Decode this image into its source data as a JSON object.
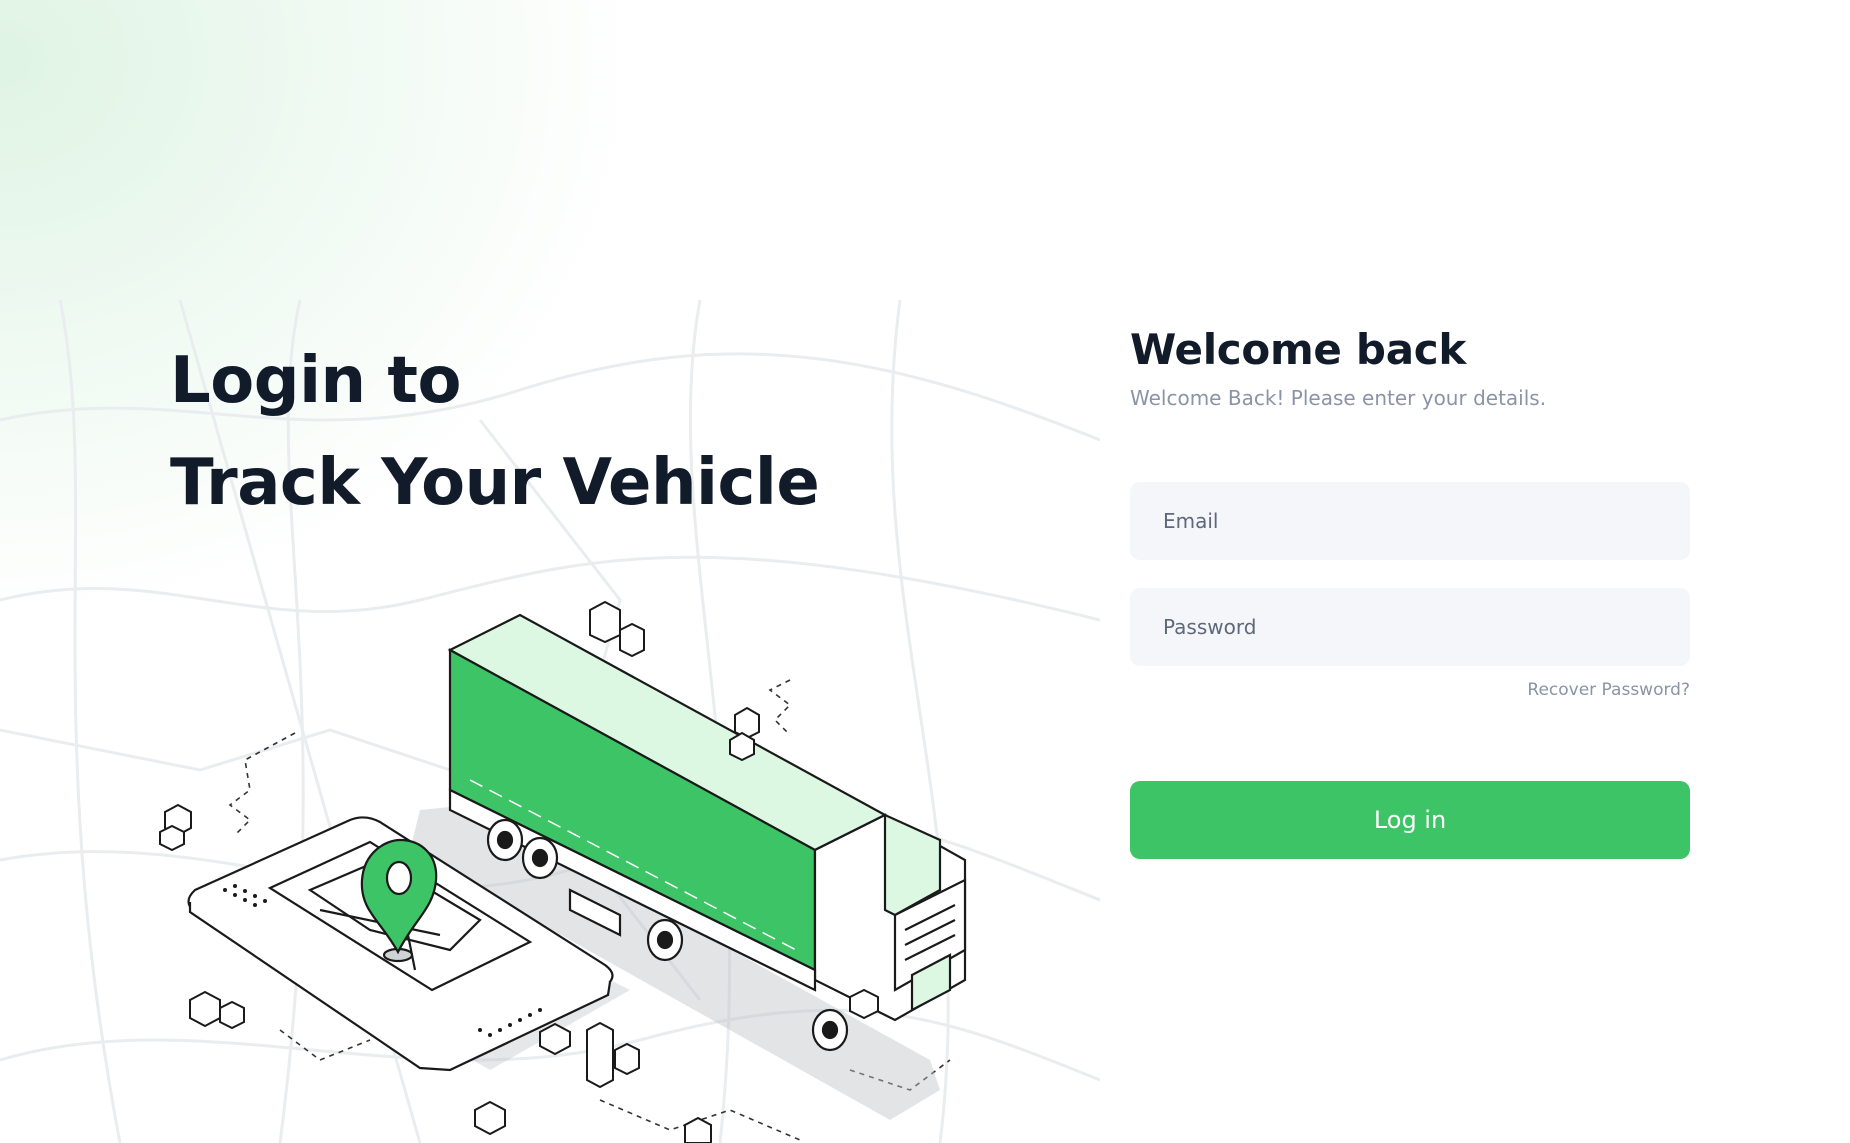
{
  "hero": {
    "line1": "Login to",
    "line2": "Track Your Vehicle"
  },
  "login": {
    "title": "Welcome back",
    "subtitle": "Welcome Back! Please enter your details.",
    "email_placeholder": "Email",
    "password_placeholder": "Password",
    "recover_label": "Recover Password?",
    "submit_label": "Log in"
  },
  "colors": {
    "accent": "#3cc466",
    "accent_light": "#dcf7e2",
    "heading": "#111b2a",
    "muted": "#8a94a6",
    "field_bg": "#f5f6fa"
  }
}
